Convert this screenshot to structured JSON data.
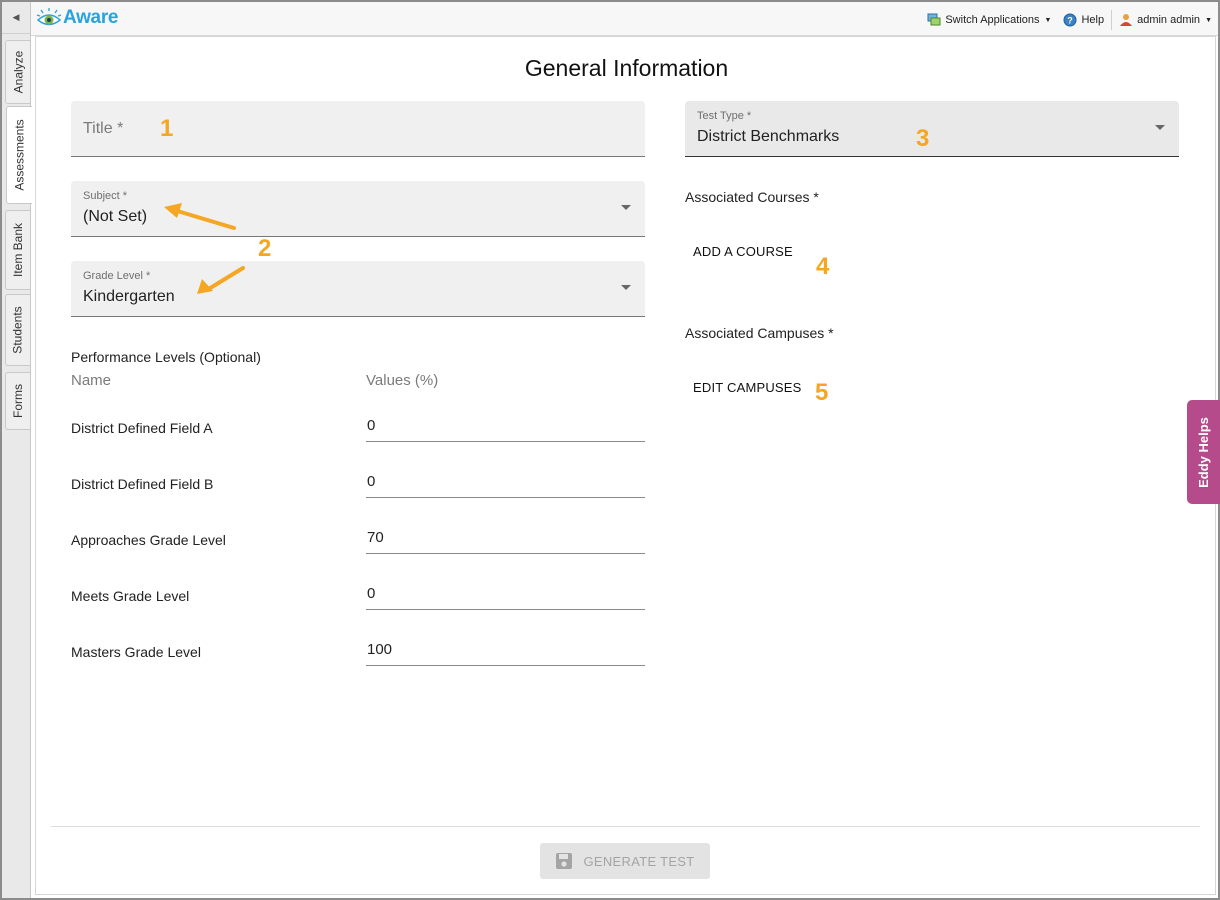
{
  "app": {
    "name": "Aware"
  },
  "topbar": {
    "switch_apps": "Switch Applications",
    "help": "Help",
    "user": "admin admin"
  },
  "side_tabs": [
    "Analyze",
    "Assessments",
    "Item Bank",
    "Students",
    "Forms"
  ],
  "form": {
    "heading": "General Information",
    "title_field": {
      "placeholder": "Title *"
    },
    "subject": {
      "label": "Subject *",
      "value": "(Not Set)"
    },
    "grade_level": {
      "label": "Grade Level *",
      "value": "Kindergarten"
    },
    "test_type": {
      "label": "Test Type *",
      "value": "District Benchmarks"
    },
    "performance": {
      "heading": "Performance Levels (Optional)",
      "col_name": "Name",
      "col_values": "Values (%)",
      "rows": [
        {
          "name": "District Defined Field A",
          "value": "0"
        },
        {
          "name": "District Defined Field B",
          "value": "0"
        },
        {
          "name": "Approaches Grade Level",
          "value": "70"
        },
        {
          "name": "Meets Grade Level",
          "value": "0"
        },
        {
          "name": "Masters Grade Level",
          "value": "100"
        }
      ]
    },
    "courses": {
      "label": "Associated Courses *",
      "button": "ADD A COURSE"
    },
    "campuses": {
      "label": "Associated Campuses *",
      "button": "EDIT CAMPUSES"
    },
    "generate": "GENERATE TEST"
  },
  "callouts": [
    "1",
    "2",
    "3",
    "4",
    "5"
  ],
  "eddy": "Eddy Helps",
  "colors": {
    "accent": "#2aa3dc",
    "callout": "#f5a623",
    "eddy": "#b64b8c"
  }
}
